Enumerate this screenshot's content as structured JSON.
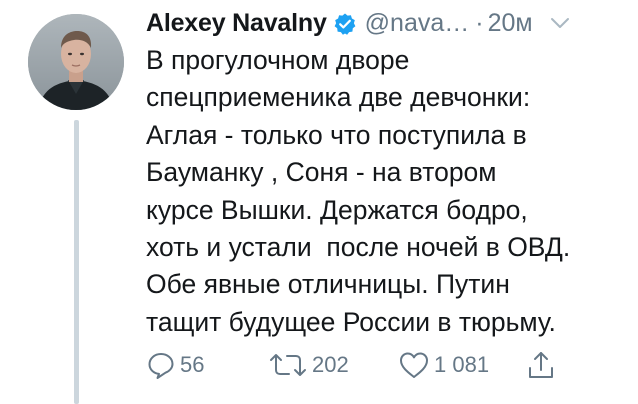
{
  "tweet": {
    "display_name": "Alexey Navalny",
    "handle": "@nava…",
    "separator": "·",
    "time": "20м",
    "text_lines": [
      "В прогулочном дворе",
      "спецприеменика две девчонки:",
      "Аглая - только что поступила в",
      "Бауманку , Соня - на втором",
      "курсе Вышки. Держатся бодро,",
      "хоть и устали  после ночей в ОВД.",
      "Обе явные отличницы. Путин",
      "тащит будущее России в тюрьму."
    ],
    "actions": {
      "reply_count": "56",
      "retweet_count": "202",
      "like_count": "1 081"
    }
  },
  "icons": {
    "verified": "verified-badge-icon",
    "chevron": "chevron-down-icon",
    "reply": "reply-icon",
    "retweet": "retweet-icon",
    "like": "heart-icon",
    "share": "share-icon"
  },
  "colors": {
    "text": "#14171a",
    "secondary": "#657786",
    "verified": "#1da1f2",
    "thread_line": "#ccd6dd"
  }
}
